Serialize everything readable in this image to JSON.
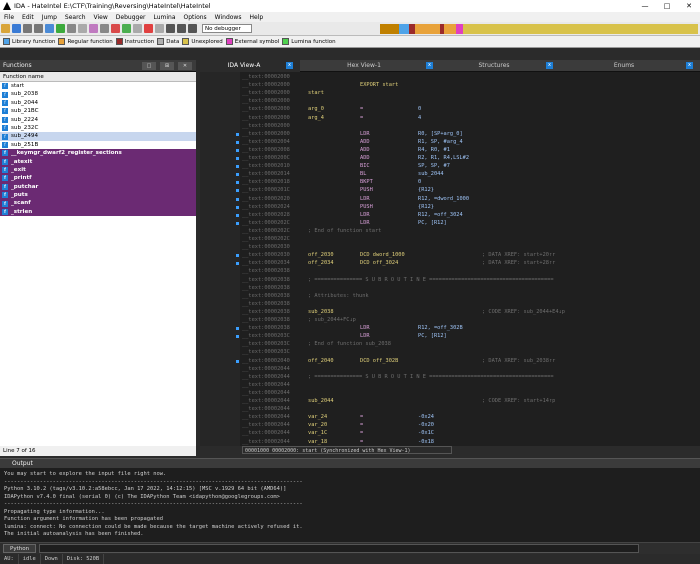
{
  "title": "IDA - HateIntel E:\\CTF\\Training\\Reversing\\HateIntel\\HateIntel",
  "menu": [
    "File",
    "Edit",
    "Jump",
    "Search",
    "View",
    "Debugger",
    "Lumina",
    "Options",
    "Windows",
    "Help"
  ],
  "toolbar": {
    "debugger": "No debugger"
  },
  "legend": [
    {
      "label": "Library function",
      "color": "#4fa3e8"
    },
    {
      "label": "Regular function",
      "color": "#e8a23a"
    },
    {
      "label": "Instruction",
      "color": "#9b2a2a"
    },
    {
      "label": "Data",
      "color": "#b0b0b0"
    },
    {
      "label": "Unexplored",
      "color": "#d8c24a"
    },
    {
      "label": "External symbol",
      "color": "#e040c0"
    },
    {
      "label": "Lumina function",
      "color": "#4ed04e"
    }
  ],
  "functions": {
    "title": "Functions",
    "column": "Function name",
    "items": [
      {
        "name": "start",
        "kind": "reg"
      },
      {
        "name": "sub_2038",
        "kind": "reg"
      },
      {
        "name": "sub_2044",
        "kind": "reg"
      },
      {
        "name": "sub_21BC",
        "kind": "reg"
      },
      {
        "name": "sub_2224",
        "kind": "reg"
      },
      {
        "name": "sub_232C",
        "kind": "reg"
      },
      {
        "name": "sub_2494",
        "kind": "sel"
      },
      {
        "name": "sub_251B",
        "kind": "reg"
      },
      {
        "name": "__keymgr_dwarf2_register_sections",
        "kind": "lib"
      },
      {
        "name": "_atexit",
        "kind": "lib"
      },
      {
        "name": "_exit",
        "kind": "lib"
      },
      {
        "name": "_printf",
        "kind": "lib"
      },
      {
        "name": "_putchar",
        "kind": "lib"
      },
      {
        "name": "_puts",
        "kind": "lib"
      },
      {
        "name": "_scanf",
        "kind": "lib"
      },
      {
        "name": "_strlen",
        "kind": "lib"
      }
    ],
    "status": "Line 7 of 16"
  },
  "tabs": [
    {
      "label": "IDA View-A",
      "active": true
    },
    {
      "label": "Hex View-1",
      "active": false
    },
    {
      "label": "Structures",
      "active": false
    },
    {
      "label": "Enums",
      "active": false
    }
  ],
  "disasm": [
    {
      "a": "__text:00002000",
      "l": "",
      "m": "",
      "o": "",
      "c": ""
    },
    {
      "a": "__text:00002000",
      "l": "",
      "m": "EXPORT start",
      "o": "",
      "c": ""
    },
    {
      "a": "__text:00002000",
      "l": "start",
      "m": "",
      "o": "",
      "c": ""
    },
    {
      "a": "__text:00002000",
      "l": "",
      "m": "",
      "o": "",
      "c": ""
    },
    {
      "a": "__text:00002000",
      "l": "arg_0",
      "m": "=",
      "o": "0",
      "c": ""
    },
    {
      "a": "__text:00002000",
      "l": "arg_4",
      "m": "=",
      "o": "4",
      "c": ""
    },
    {
      "a": "__text:00002000",
      "l": "",
      "m": "",
      "o": "",
      "c": ""
    },
    {
      "a": "__text:00002000",
      "l": "",
      "m": "LDR",
      "o": "R0, [SP+arg_0]",
      "c": ""
    },
    {
      "a": "__text:00002004",
      "l": "",
      "m": "ADD",
      "o": "R1, SP, #arg_4",
      "c": ""
    },
    {
      "a": "__text:00002008",
      "l": "",
      "m": "ADD",
      "o": "R4, R0, #1",
      "c": ""
    },
    {
      "a": "__text:0000200C",
      "l": "",
      "m": "ADD",
      "o": "R2, R1, R4,LSL#2",
      "c": ""
    },
    {
      "a": "__text:00002010",
      "l": "",
      "m": "BIC",
      "o": "SP, SP, #7",
      "c": ""
    },
    {
      "a": "__text:00002014",
      "l": "",
      "m": "BL",
      "o": "sub_2044",
      "c": ""
    },
    {
      "a": "__text:00002018",
      "l": "",
      "m": "BKPT",
      "o": "0",
      "c": ""
    },
    {
      "a": "__text:0000201C",
      "l": "",
      "m": "PUSH",
      "o": "{R12}",
      "c": ""
    },
    {
      "a": "__text:00002020",
      "l": "",
      "m": "LDR",
      "o": "R12, =dword_1000",
      "c": ""
    },
    {
      "a": "__text:00002024",
      "l": "",
      "m": "PUSH",
      "o": "{R12}",
      "c": ""
    },
    {
      "a": "__text:00002028",
      "l": "",
      "m": "LDR",
      "o": "R12, =off_3024",
      "c": ""
    },
    {
      "a": "__text:0000202C",
      "l": "",
      "m": "LDR",
      "o": "PC, [R12]",
      "c": ""
    },
    {
      "a": "__text:0000202C",
      "l": "",
      "m": "",
      "o": "",
      "c": "; End of function start"
    },
    {
      "a": "__text:0000202C",
      "l": "",
      "m": "",
      "o": "",
      "c": ""
    },
    {
      "a": "__text:00002030",
      "l": "",
      "m": "",
      "o": "",
      "c": ""
    },
    {
      "a": "__text:00002030",
      "l": "off_2030",
      "m": "DCD dword_1000",
      "o": "",
      "c": "; DATA XREF: start+20↑r"
    },
    {
      "a": "__text:00002034",
      "l": "off_2034",
      "m": "DCD off_3024",
      "o": "",
      "c": "; DATA XREF: start+28↑r"
    },
    {
      "a": "__text:00002038",
      "l": "",
      "m": "",
      "o": "",
      "c": ""
    },
    {
      "a": "__text:00002038",
      "l": "",
      "m": "",
      "o": "",
      "c": "; =============== S U B R O U T I N E ======================================="
    },
    {
      "a": "__text:00002038",
      "l": "",
      "m": "",
      "o": "",
      "c": ""
    },
    {
      "a": "__text:00002038",
      "l": "",
      "m": "",
      "o": "",
      "c": "; Attributes: thunk"
    },
    {
      "a": "__text:00002038",
      "l": "",
      "m": "",
      "o": "",
      "c": ""
    },
    {
      "a": "__text:00002038",
      "l": "sub_2038",
      "m": "",
      "o": "",
      "c": "; CODE XREF: sub_2044+E4↓p"
    },
    {
      "a": "__text:00002038",
      "l": "",
      "m": "",
      "o": "",
      "c": "; sub_2044+FC↓p"
    },
    {
      "a": "__text:00002038",
      "l": "",
      "m": "LDR",
      "o": "R12, =off_302B",
      "c": ""
    },
    {
      "a": "__text:0000203C",
      "l": "",
      "m": "LDR",
      "o": "PC, [R12]",
      "c": ""
    },
    {
      "a": "__text:0000203C",
      "l": "",
      "m": "",
      "o": "",
      "c": "; End of function sub_2038"
    },
    {
      "a": "__text:0000203C",
      "l": "",
      "m": "",
      "o": "",
      "c": ""
    },
    {
      "a": "__text:00002040",
      "l": "off_2040",
      "m": "DCD off_302B",
      "o": "",
      "c": "; DATA XREF: sub_2038↑r"
    },
    {
      "a": "__text:00002044",
      "l": "",
      "m": "",
      "o": "",
      "c": ""
    },
    {
      "a": "__text:00002044",
      "l": "",
      "m": "",
      "o": "",
      "c": "; =============== S U B R O U T I N E ======================================="
    },
    {
      "a": "__text:00002044",
      "l": "",
      "m": "",
      "o": "",
      "c": ""
    },
    {
      "a": "__text:00002044",
      "l": "",
      "m": "",
      "o": "",
      "c": ""
    },
    {
      "a": "__text:00002044",
      "l": "sub_2044",
      "m": "",
      "o": "",
      "c": "; CODE XREF: start+14↑p"
    },
    {
      "a": "__text:00002044",
      "l": "",
      "m": "",
      "o": "",
      "c": ""
    },
    {
      "a": "__text:00002044",
      "l": "var_24",
      "m": "=",
      "o": "-0x24",
      "c": ""
    },
    {
      "a": "__text:00002044",
      "l": "var_20",
      "m": "=",
      "o": "-0x20",
      "c": ""
    },
    {
      "a": "__text:00002044",
      "l": "var_1C",
      "m": "=",
      "o": "-0x1C",
      "c": ""
    },
    {
      "a": "__text:00002044",
      "l": "var_18",
      "m": "=",
      "o": "-0x18",
      "c": ""
    }
  ],
  "disasm_footer": "00001000 00002000: start (Synchronized with Hex View-1)",
  "output": {
    "title": "Output",
    "lines": [
      "You may start to explore the input file right now.",
      "--------------------------------------------------------------------------------------------",
      "Python 3.10.2 (tags/v3.10.2:a58ebcc, Jan 17 2022, 14:12:15) [MSC v.1929 64 bit (AMD64)]",
      "IDAPython v7.4.0 final (serial 0) (c) The IDAPython Team <idapython@googlegroups.com>",
      "--------------------------------------------------------------------------------------------",
      "Propagating type information...",
      "Function argument information has been propagated",
      "lumina: connect: No connection could be made because the target machine actively refused it.",
      "The initial autoanalysis has been finished."
    ]
  },
  "python_button": "Python",
  "status": {
    "au": "AU:",
    "state": "idle",
    "dir": "Down",
    "disk": "Disk: 520B"
  }
}
